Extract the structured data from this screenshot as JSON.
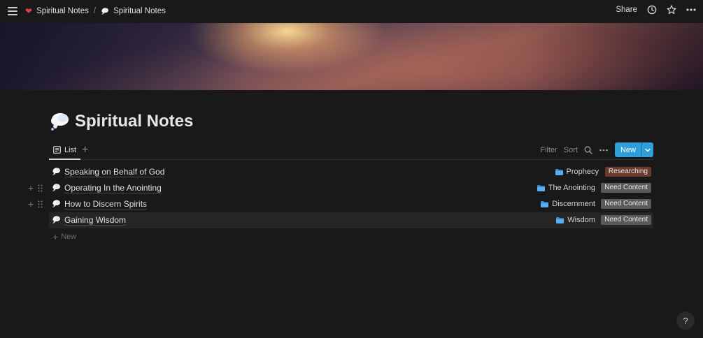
{
  "breadcrumb": {
    "parent": "Spiritual Notes",
    "current": "Spiritual Notes"
  },
  "topbar": {
    "share_label": "Share"
  },
  "page": {
    "title": "Spiritual Notes"
  },
  "view": {
    "tab_label": "List",
    "filter_label": "Filter",
    "sort_label": "Sort",
    "new_label": "New"
  },
  "rows": [
    {
      "name": "Speaking on Behalf of God",
      "category": "Prophecy",
      "status": "Researching"
    },
    {
      "name": "Operating In the Anointing",
      "category": "The Anointing",
      "status": "Need Content"
    },
    {
      "name": "How to Discern Spirits",
      "category": "Discernment",
      "status": "Need Content"
    },
    {
      "name": "Gaining Wisdom",
      "category": "Wisdom",
      "status": "Need Content"
    }
  ],
  "new_row_label": "New",
  "help_label": "?",
  "colors": {
    "accent": "#2e9fd8",
    "researching": "#6a3b2c",
    "need_content": "#5a5a5a"
  }
}
